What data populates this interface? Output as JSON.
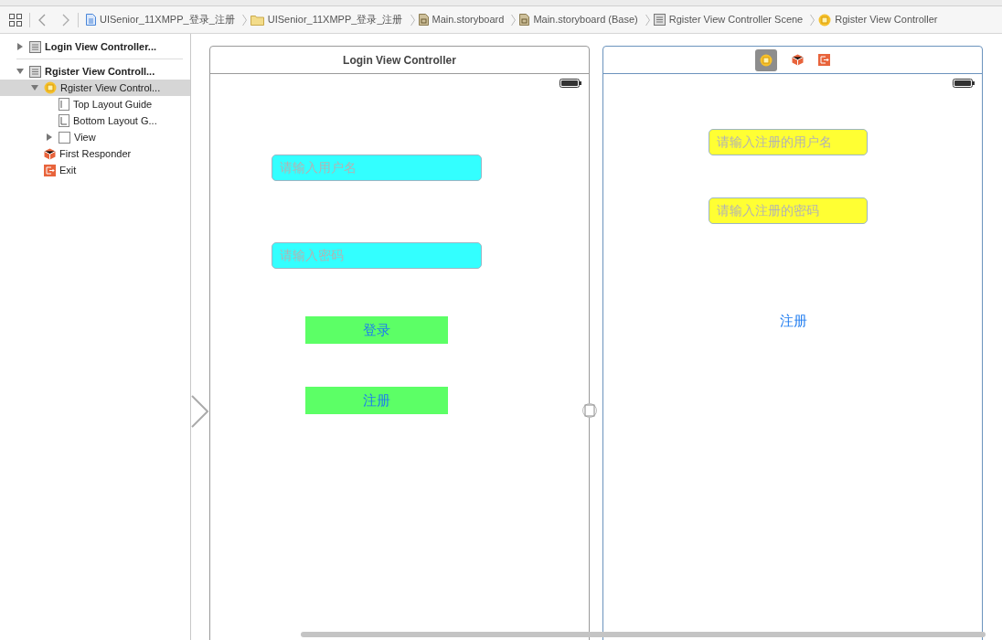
{
  "breadcrumbs": [
    {
      "label": "UISenior_11XMPP_登录_注册",
      "kind": "file"
    },
    {
      "label": "UISenior_11XMPP_登录_注册",
      "kind": "folder"
    },
    {
      "label": "Main.storyboard",
      "kind": "storyboard"
    },
    {
      "label": "Main.storyboard (Base)",
      "kind": "storyboard"
    },
    {
      "label": "Rgister View Controller Scene",
      "kind": "scene"
    },
    {
      "label": "Rgister View Controller",
      "kind": "controller"
    }
  ],
  "outline": [
    {
      "label": "Login View Controller...",
      "kind": "scene",
      "expanded": false,
      "selected": false
    },
    {
      "label": "Rgister View Controll...",
      "kind": "scene",
      "expanded": true,
      "selected": false,
      "children": [
        {
          "label": "Rgister View Control...",
          "kind": "controller",
          "expanded": true,
          "selected": true,
          "children": [
            {
              "label": "Top Layout Guide",
              "kind": "guide-top",
              "selected": false
            },
            {
              "label": "Bottom Layout G...",
              "kind": "guide-bottom",
              "selected": false
            },
            {
              "label": "View",
              "kind": "view",
              "expanded": false,
              "selected": false
            }
          ]
        },
        {
          "label": "First Responder",
          "kind": "responder",
          "selected": false
        },
        {
          "label": "Exit",
          "kind": "exit",
          "selected": false
        }
      ]
    }
  ],
  "scenes": [
    {
      "title": "Login View Controller",
      "selected": false,
      "controls": [
        {
          "kind": "field",
          "placeholder": "请输入用户名",
          "color": "#33ffff"
        },
        {
          "kind": "field",
          "placeholder": "请输入密码",
          "color": "#33ffff"
        },
        {
          "kind": "button",
          "label": "登录",
          "color": "#5cff66"
        },
        {
          "kind": "button",
          "label": "注册",
          "color": "#5cff66"
        }
      ]
    },
    {
      "selected": true,
      "controls": [
        {
          "kind": "field",
          "placeholder": "请输入注册的用户名",
          "color": "#ffff33"
        },
        {
          "kind": "field",
          "placeholder": "请输入注册的密码",
          "color": "#ffff33"
        },
        {
          "kind": "link",
          "label": "注册"
        }
      ]
    }
  ]
}
